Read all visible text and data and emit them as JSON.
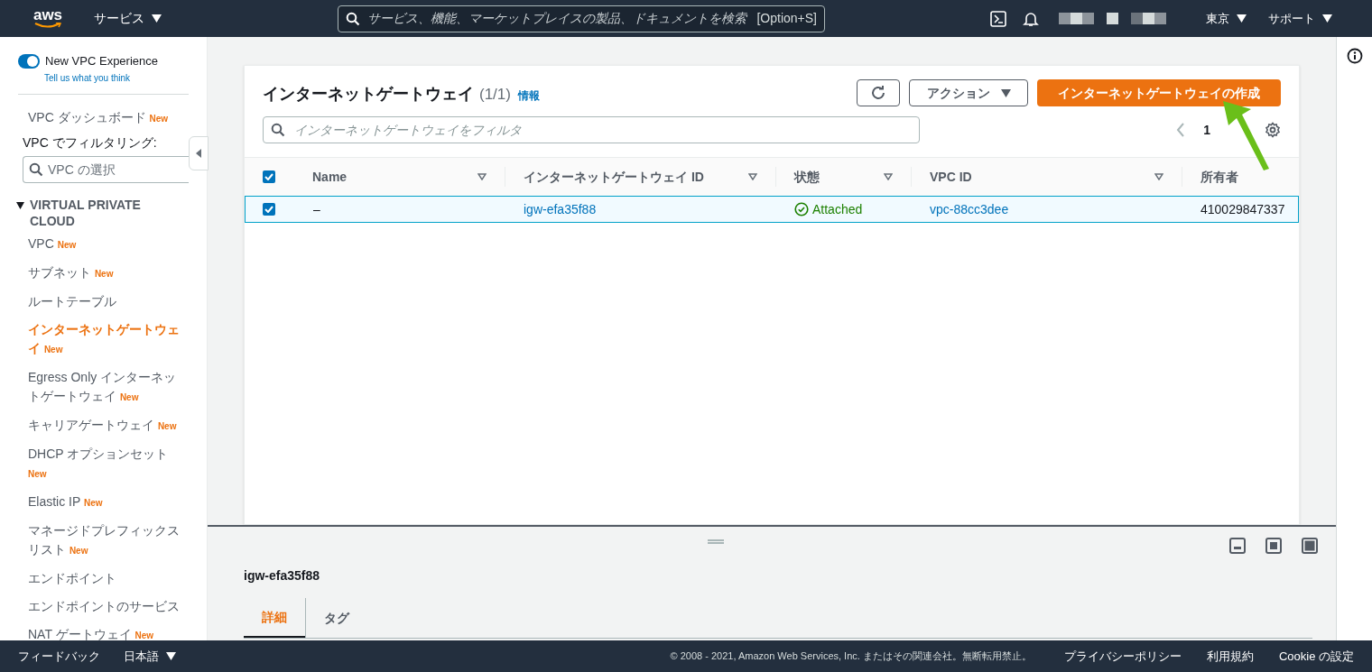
{
  "top_bar": {
    "logo": "aws",
    "services_menu": "サービス",
    "search": {
      "placeholder": "サービス、機能、マーケットプレイスの製品、ドキュメントを検索",
      "shortcut": "[Option+S]"
    },
    "region_menu": "東京",
    "support_menu": "サポート"
  },
  "sidebar": {
    "new_experience": {
      "label": "New VPC Experience",
      "on": true,
      "link": "Tell us what you think"
    },
    "dashboard": {
      "label": "VPC ダッシュボード",
      "badge": "New"
    },
    "filter_label": "VPC でフィルタリング:",
    "filter_field": {
      "placeholder": "VPC の選択"
    },
    "section": {
      "title": "VIRTUAL PRIVATE CLOUD",
      "expanded": true
    },
    "items": [
      {
        "label": "VPC",
        "badge": "New",
        "selected": false
      },
      {
        "label": "サブネット",
        "badge": "New",
        "selected": false
      },
      {
        "label": "ルートテーブル",
        "selected": false
      },
      {
        "label": "インターネットゲートウェイ",
        "badge": "New",
        "selected": true
      },
      {
        "label": "Egress Only インターネットゲートウェイ",
        "badge": "New",
        "selected": false
      },
      {
        "label": "キャリアゲートウェイ",
        "badge": "New",
        "selected": false
      },
      {
        "label": "DHCP オプションセット",
        "badge": "New",
        "selected": false
      },
      {
        "label": "Elastic IP",
        "badge": "New",
        "selected": false
      },
      {
        "label": "マネージドプレフィックスリスト",
        "badge": "New",
        "selected": false
      },
      {
        "label": "エンドポイント",
        "selected": false
      },
      {
        "label": "エンドポイントのサービス",
        "selected": false
      },
      {
        "label": "NAT ゲートウェイ",
        "badge": "New",
        "selected": false
      }
    ]
  },
  "table": {
    "title": "インターネットゲートウェイ",
    "count": "(1/1)",
    "info_link": "情報",
    "actions_button": "アクション",
    "create_button": "インターネットゲートウェイの作成",
    "filter": {
      "placeholder": "インターネットゲートウェイをフィルタ"
    },
    "page": "1",
    "header_checked": true,
    "columns": [
      {
        "label": "Name",
        "sortable": true
      },
      {
        "label": "インターネットゲートウェイ ID",
        "sortable": true
      },
      {
        "label": "状態",
        "sortable": true
      },
      {
        "label": "VPC ID",
        "sortable": true
      },
      {
        "label": "所有者",
        "sortable": false
      }
    ],
    "rows": [
      {
        "selected": true,
        "cells": [
          {
            "kind": "text",
            "text": "–"
          },
          {
            "kind": "link",
            "text": "igw-efa35f88"
          },
          {
            "kind": "status",
            "text": "Attached"
          },
          {
            "kind": "link",
            "text": "vpc-88cc3dee"
          },
          {
            "kind": "text",
            "text": "410029847337"
          }
        ]
      }
    ]
  },
  "detail_panel": {
    "title": "igw-efa35f88",
    "tabs": [
      {
        "label": "詳細",
        "selected": true
      },
      {
        "label": "タグ",
        "selected": false
      }
    ]
  },
  "footer": {
    "feedback": "フィードバック",
    "language": "日本語",
    "copyright": "© 2008 - 2021, Amazon Web Services, Inc. またはその関連会社。無断転用禁止。",
    "links": [
      "プライバシーポリシー",
      "利用規約",
      "Cookie の設定"
    ]
  }
}
